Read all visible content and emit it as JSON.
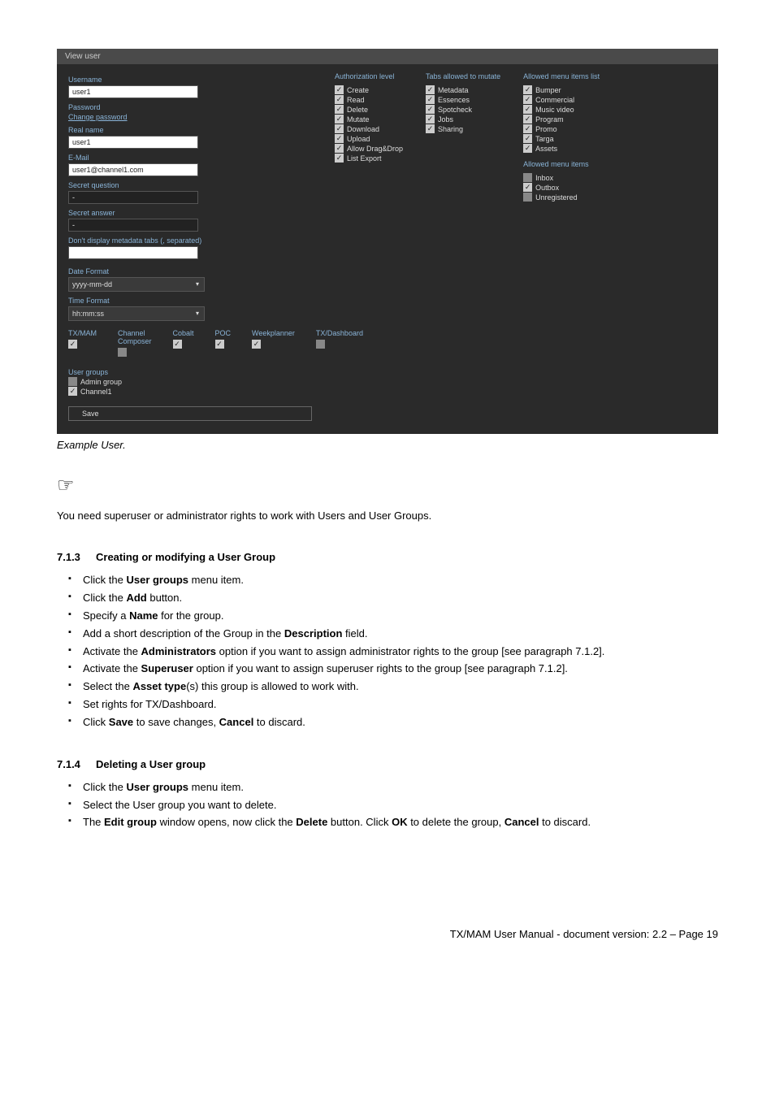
{
  "screenshot": {
    "title": "View user",
    "left": {
      "username_l": "Username",
      "username_v": "user1",
      "password_l": "Password",
      "change_pw": "Change password",
      "realname_l": "Real name",
      "realname_v": "user1",
      "email_l": "E-Mail",
      "email_v": "user1@channel1.com",
      "secretq_l": "Secret question",
      "secretq_v": "-",
      "secreta_l": "Secret answer",
      "secreta_v": "-",
      "dontdisplay_l": "Don't display metadata tabs (, separated)",
      "datefmt_l": "Date Format",
      "datefmt_v": "yyyy-mm-dd",
      "timefmt_l": "Time Format",
      "timefmt_v": "hh:mm:ss"
    },
    "auth": {
      "heading": "Authorization level",
      "items": [
        "Create",
        "Read",
        "Delete",
        "Mutate",
        "Download",
        "Upload",
        "Allow Drag&Drop",
        "List Export"
      ]
    },
    "tabs": {
      "heading": "Tabs allowed to mutate",
      "items": [
        "Metadata",
        "Essences",
        "Spotcheck",
        "Jobs",
        "Sharing"
      ]
    },
    "menulist": {
      "heading": "Allowed menu items list",
      "items": [
        "Bumper",
        "Commercial",
        "Music video",
        "Program",
        "Promo",
        "Targa",
        "Assets"
      ]
    },
    "menuitems": {
      "heading": "Allowed menu items",
      "items": [
        {
          "label": "Inbox",
          "checked": false
        },
        {
          "label": "Outbox",
          "checked": true
        },
        {
          "label": "Unregistered",
          "checked": false
        }
      ]
    },
    "apps": {
      "items": [
        {
          "name": "TX/MAM",
          "checked": true
        },
        {
          "name": "Channel Composer",
          "checked": false
        },
        {
          "name": "Cobalt",
          "checked": true
        },
        {
          "name": "POC",
          "checked": true
        },
        {
          "name": "Weekplanner",
          "checked": true
        },
        {
          "name": "TX/Dashboard",
          "checked": false
        }
      ]
    },
    "usergroups": {
      "heading": "User groups",
      "items": [
        {
          "label": "Admin group",
          "checked": false
        },
        {
          "label": "Channel1",
          "checked": true
        }
      ]
    },
    "save": "Save"
  },
  "caption": "Example User.",
  "note": "You need superuser or administrator rights to work with Users and User Groups.",
  "s713": {
    "num": "7.1.3",
    "title": "Creating or modifying a User Group",
    "items": [
      {
        "pre": "Click the ",
        "b": "User groups",
        "post": " menu item."
      },
      {
        "pre": "Click the ",
        "b": "Add",
        "post": " button."
      },
      {
        "pre": "Specify a ",
        "b": "Name",
        "post": " for the group."
      },
      {
        "pre": "Add a short description of the Group in the ",
        "b": "Description",
        "post": " field."
      },
      {
        "pre": "Activate the ",
        "b": "Administrators",
        "post": " option if you want to assign administrator rights to the group [see paragraph 7.1.2]."
      },
      {
        "pre": "Activate the ",
        "b": "Superuser",
        "post": " option if you want to assign superuser rights to the group [see paragraph 7.1.2]."
      },
      {
        "pre": "Select the ",
        "b": "Asset type",
        "post": "(s) this group is allowed to work with."
      },
      {
        "pre": "Set rights for TX/Dashboard.",
        "b": "",
        "post": ""
      },
      {
        "pre": "Click ",
        "b": "Save",
        "post": " to save changes, ",
        "b2": "Cancel",
        "post2": " to discard."
      }
    ]
  },
  "s714": {
    "num": "7.1.4",
    "title": "Deleting a User group",
    "items": [
      {
        "pre": "Click the ",
        "b": "User groups",
        "post": " menu item."
      },
      {
        "pre": "Select the User group you want to delete.",
        "b": "",
        "post": ""
      },
      {
        "pre": "The ",
        "b": "Edit group",
        "post": " window opens, now click the ",
        "b2": "Delete",
        "post2": " button. Click ",
        "b3": "OK",
        "post3": " to delete the group, ",
        "b4": "Cancel",
        "post4": " to discard."
      }
    ]
  },
  "footer": "TX/MAM User Manual - document version: 2.2 – Page 19"
}
